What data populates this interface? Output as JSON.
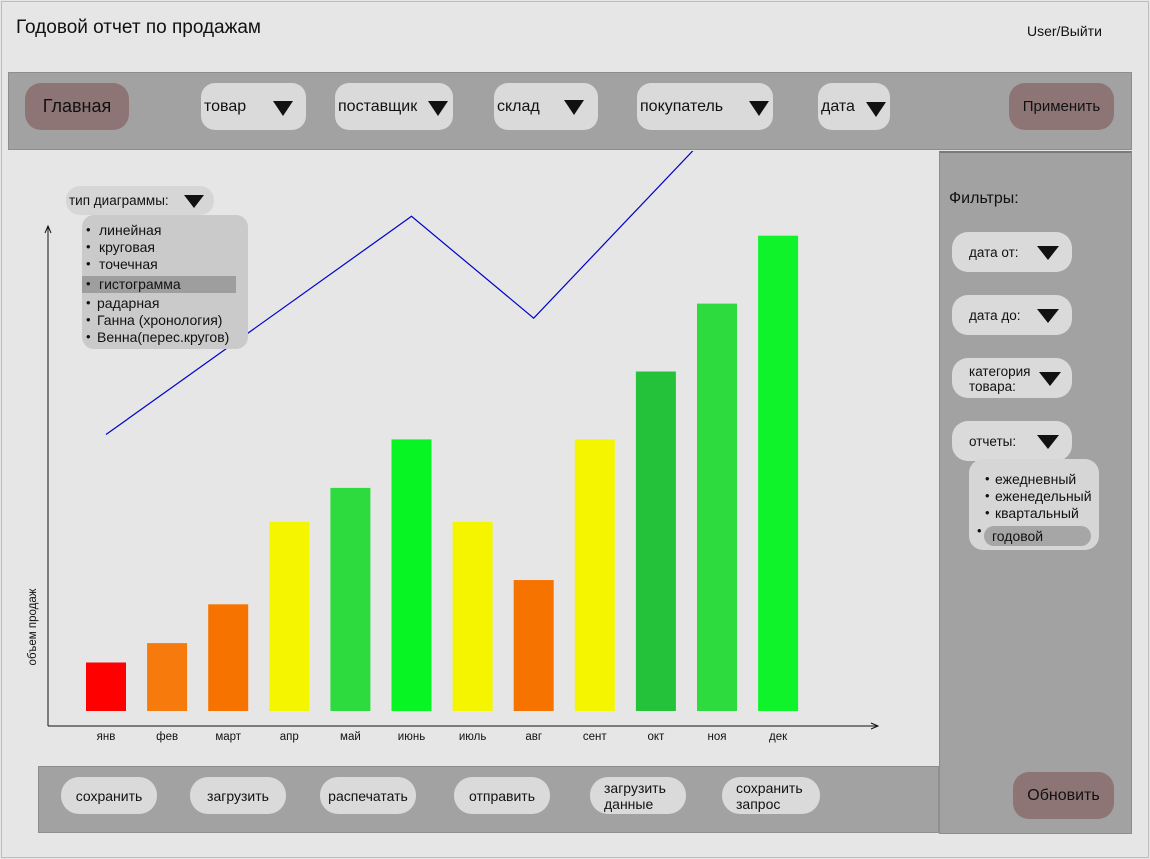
{
  "header": {
    "title": "Годовой отчет по продажам",
    "user_link": "User/Выйти"
  },
  "toolbar": {
    "home_label": "Главная",
    "filters": [
      {
        "label": "товар"
      },
      {
        "label": "поставщик"
      },
      {
        "label": "склад"
      },
      {
        "label": "покупатель"
      },
      {
        "label": "дата"
      }
    ],
    "apply_label": "Применить"
  },
  "chart_type": {
    "label": "тип диаграммы:",
    "options": [
      "линейная",
      "круговая",
      "точечная",
      "гистограмма",
      "радарная",
      "Ганна (хронология)",
      "Венна(перес.кругов)"
    ],
    "selected": "гистограмма"
  },
  "sidebar": {
    "title": "Фильтры:",
    "date_from": "дата от:",
    "date_to": "дата до:",
    "category_line1": "категория",
    "category_line2": "товара:",
    "reports_label": "отчеты:",
    "reports_options": [
      "ежедневный",
      "еженедельный",
      "квартальный",
      "годовой"
    ],
    "reports_selected": "годовой",
    "refresh_label": "Обновить"
  },
  "chart_data": {
    "type": "bar",
    "ylabel": "объем продаж",
    "categories": [
      "янв",
      "фев",
      "март",
      "апр",
      "май",
      "июнь",
      "июль",
      "авг",
      "сент",
      "окт",
      "ноя",
      "дек"
    ],
    "values": [
      10,
      14,
      22,
      39,
      46,
      56,
      39,
      27,
      56,
      70,
      84,
      98
    ],
    "bar_colors": [
      "#ff0000",
      "#f77b0c",
      "#f77300",
      "#f5f500",
      "#2ddb3f",
      "#06f523",
      "#f5f500",
      "#f77300",
      "#f5f500",
      "#24c23a",
      "#2ddb3f",
      "#0ef32a"
    ],
    "ylim": [
      0,
      100
    ],
    "trend_line": {
      "x": [
        "янв",
        "июнь",
        "авг",
        "дек"
      ],
      "y": [
        57,
        102,
        81,
        134
      ],
      "color": "#0000cc"
    }
  },
  "actions": {
    "save": "сохранить",
    "load": "загрузить",
    "print": "распечатать",
    "send": "отправить",
    "load_data_1": "загрузить",
    "load_data_2": "данные",
    "save_query_1": "сохранить",
    "save_query_2": "запрос"
  }
}
